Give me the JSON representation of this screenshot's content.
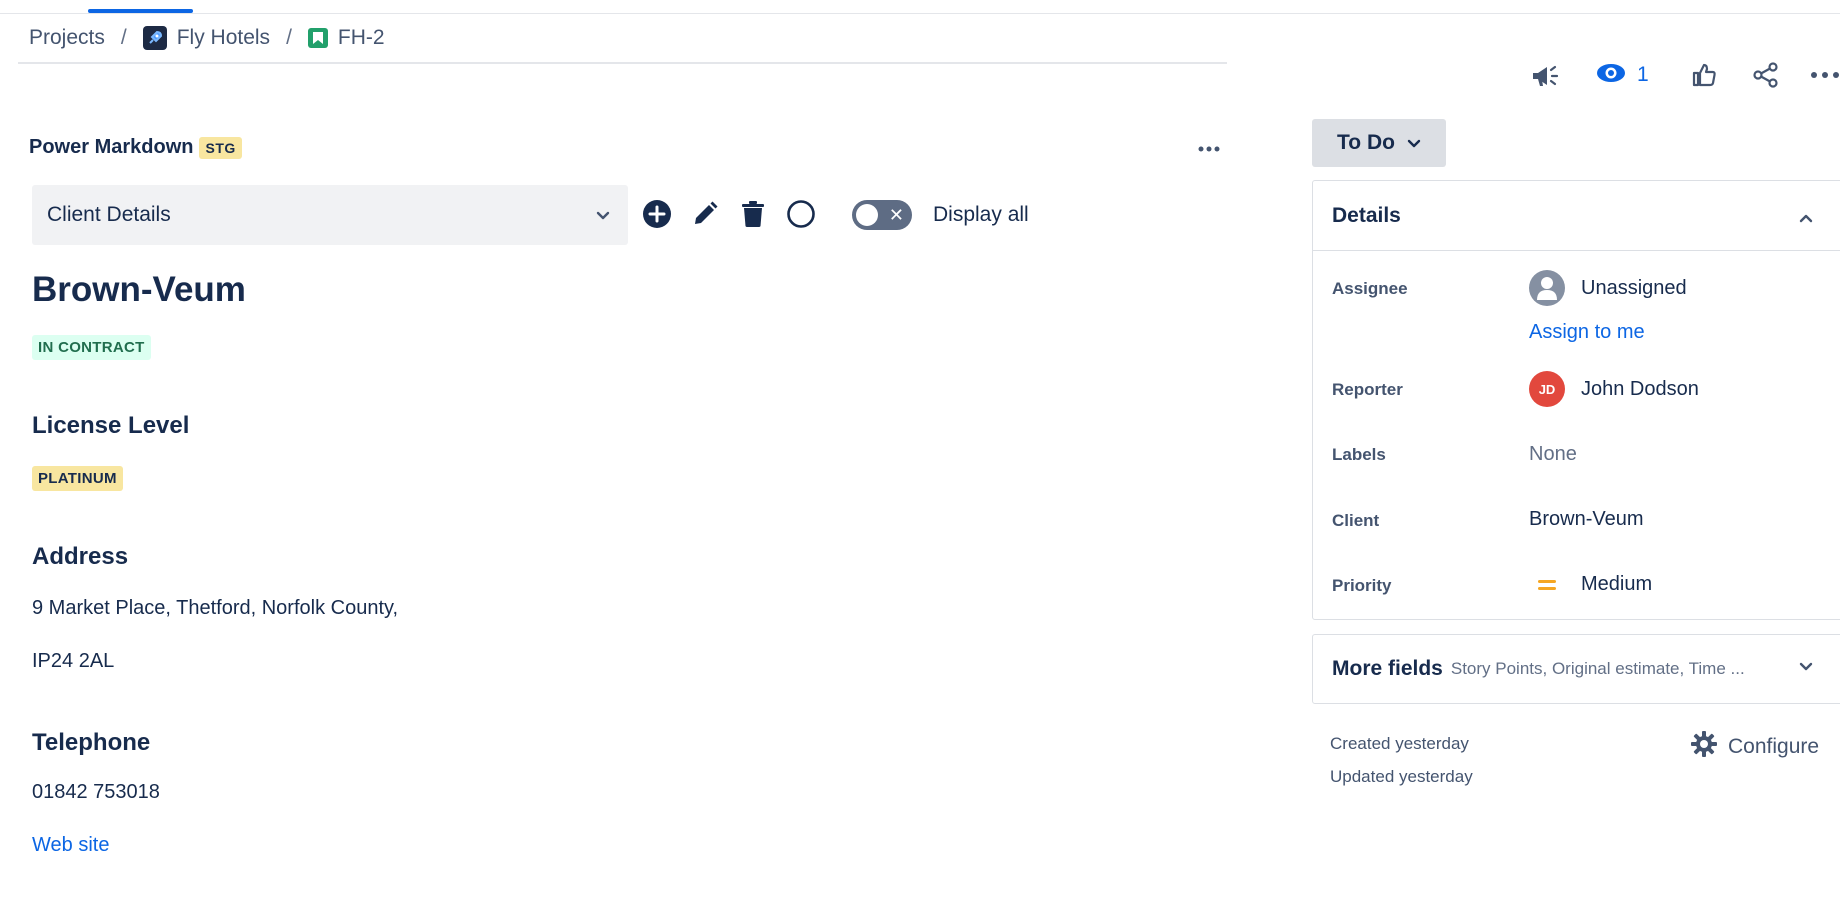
{
  "breadcrumb": {
    "projects": "Projects",
    "project": "Fly Hotels",
    "issue_key": "FH-2",
    "separator": "/"
  },
  "top_actions": {
    "icons": [
      "megaphone-icon",
      "eye-icon",
      "thumbs-up-icon",
      "share-icon",
      "more-icon"
    ],
    "watch_count": "1"
  },
  "power_markdown": {
    "title": "Power Markdown",
    "badge": "STG",
    "selected_page": "Client Details",
    "display_all_label": "Display all",
    "toggle_on": false
  },
  "client": {
    "name": "Brown-Veum",
    "status_lozenge": "IN CONTRACT",
    "license_heading": "License Level",
    "license_lozenge": "PLATINUM",
    "address_heading": "Address",
    "address_line1": "9 Market Place, Thetford, Norfolk County,",
    "address_line2": "IP24 2AL",
    "telephone_heading": "Telephone",
    "telephone": "01842 753018",
    "website_link": "Web site"
  },
  "status": {
    "label": "To Do"
  },
  "details": {
    "heading": "Details",
    "assignee_label": "Assignee",
    "assignee_value": "Unassigned",
    "assign_to_me": "Assign to me",
    "reporter_label": "Reporter",
    "reporter_initials": "JD",
    "reporter_value": "John Dodson",
    "labels_label": "Labels",
    "labels_value": "None",
    "client_label": "Client",
    "client_value": "Brown-Veum",
    "priority_label": "Priority",
    "priority_value": "Medium"
  },
  "more_fields": {
    "title": "More fields",
    "summary": "Story Points, Original estimate, Time ..."
  },
  "meta": {
    "created": "Created yesterday",
    "updated": "Updated yesterday",
    "configure": "Configure"
  },
  "colors": {
    "accent": "#0C66E4",
    "text": "#172B4D",
    "lozenge_green_bg": "#DCFFF1",
    "lozenge_green_text": "#216E4E",
    "lozenge_yellow_bg": "#F8E6A0",
    "priority_medium": "#F5A623",
    "reporter_avatar": "#E2483D"
  }
}
